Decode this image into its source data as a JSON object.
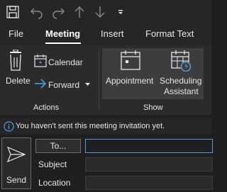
{
  "quick_access": {
    "icons": [
      "save-icon",
      "undo-icon",
      "redo-icon",
      "up-arrow-icon",
      "down-arrow-icon",
      "customize-toolbar-icon"
    ]
  },
  "tabs": [
    {
      "label": "File"
    },
    {
      "label": "Meeting",
      "active": true
    },
    {
      "label": "Insert"
    },
    {
      "label": "Format Text"
    }
  ],
  "ribbon": {
    "actions": {
      "group_label": "Actions",
      "delete_label": "Delete",
      "calendar_label": "Calendar",
      "forward_label": "Forward"
    },
    "show": {
      "group_label": "Show",
      "appointment_label": "Appointment",
      "scheduling_label_line1": "Scheduling",
      "scheduling_label_line2": "Assistant"
    }
  },
  "info_bar": {
    "message": "You haven't sent this meeting invitation yet."
  },
  "compose": {
    "send_label": "Send",
    "to_label": "To...",
    "to_value": "",
    "subject_label": "Subject",
    "subject_value": "",
    "location_label": "Location",
    "location_value": ""
  },
  "colors": {
    "background": "#1f1f1f",
    "ribbon": "#2b2b2b",
    "selected_group": "#3d3d3d",
    "accent": "#4a9be0",
    "text": "#e6e6e6"
  }
}
